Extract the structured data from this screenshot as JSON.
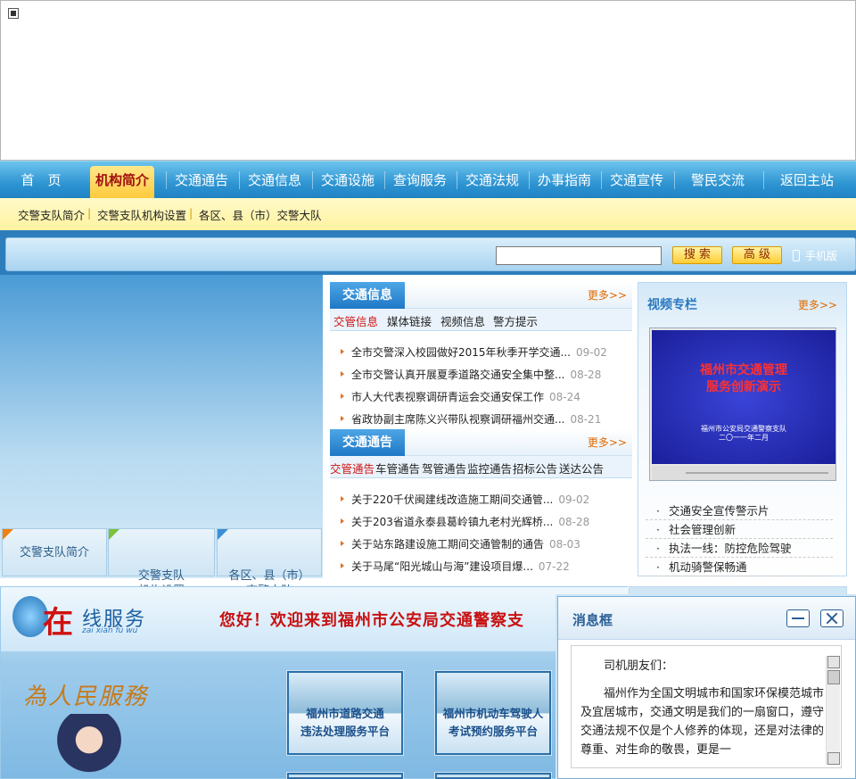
{
  "nav": {
    "items": [
      "首　页",
      "机构简介",
      "交通通告",
      "交通信息",
      "交通设施",
      "查询服务",
      "交通法规",
      "办事指南",
      "交通宣传",
      "警民交流",
      "返回主站"
    ],
    "active_index": 1
  },
  "subnav": {
    "items": [
      "交警支队简介",
      "交警支队机构设置",
      "各区、县（市）交警大队"
    ],
    "separator": "|"
  },
  "search": {
    "placeholder": "",
    "search_button": "搜 索",
    "advanced_button": "高 级",
    "mobile_link": "手机版"
  },
  "left_tabs": [
    {
      "label": "交警支队简介"
    },
    {
      "label": "交警支队\n机构设置"
    },
    {
      "label": "各区、县（市）\n交警大队"
    }
  ],
  "traffic_info": {
    "title": "交通信息",
    "more": "更多>>",
    "tabs": [
      "交管信息",
      "媒体链接",
      "视频信息",
      "警方提示"
    ],
    "active_tab": 0,
    "items": [
      {
        "text": "全市交警深入校园做好2015年秋季开学交通...",
        "date": "09-02"
      },
      {
        "text": "全市交警认真开展夏季道路交通安全集中整...",
        "date": "08-28"
      },
      {
        "text": "市人大代表视察调研青运会交通安保工作",
        "date": "08-24"
      },
      {
        "text": "省政协副主席陈义兴带队视察调研福州交通...",
        "date": "08-21"
      }
    ]
  },
  "traffic_notice": {
    "title": "交通通告",
    "more": "更多>>",
    "tabs": [
      "交管通告",
      "车管通告",
      "驾管通告",
      "监控通告",
      "招标公告",
      "送达公告"
    ],
    "active_tab": 0,
    "items": [
      {
        "text": "关于220千伏闽建线改造施工期间交通管...",
        "date": "09-02"
      },
      {
        "text": "关于203省道永泰县葛岭镇九老村光辉桥...",
        "date": "08-28"
      },
      {
        "text": "关于站东路建设施工期间交通管制的通告",
        "date": "08-03"
      },
      {
        "text": "关于马尾“阳光城山与海”建设项目爆...",
        "date": "07-22"
      }
    ]
  },
  "video": {
    "title": "视频专栏",
    "more": "更多>>",
    "screen_title_1": "福州市交通管理",
    "screen_title_2": "服务创新演示",
    "screen_sub_1": "福州市公安局交通警察支队",
    "screen_sub_2": "二〇一一年二月",
    "list": [
      "交通安全宣传警示片",
      "社会管理创新",
      "执法一线：防控危险驾驶",
      "机动骑警保畅通"
    ]
  },
  "service": {
    "zai": "在",
    "rest": "线服务",
    "pinyin": "zai xian fu wu",
    "welcome": "您好！欢迎来到福州市公安局交通警察支",
    "motto": "為人民服務",
    "tiles": [
      {
        "line1": "福州市道路交通",
        "line2": "违法处理服务平台"
      },
      {
        "line1": "福州市机动车驾驶人",
        "line2": "考试预约服务平台"
      }
    ]
  },
  "message_box": {
    "title": "消息框",
    "greeting": "司机朋友们：",
    "body": "福州作为全国文明城市和国家环保模范城市及宜居城市，交通文明是我们的一扇窗口，遵守交通法规不仅是个人修养的体现，还是对法律的尊重、对生命的敬畏，更是一"
  },
  "colors": {
    "nav_blue": "#2f95d2",
    "active_gold": "#ffc93a",
    "accent_red": "#d01414",
    "more_orange": "#e06a00"
  }
}
